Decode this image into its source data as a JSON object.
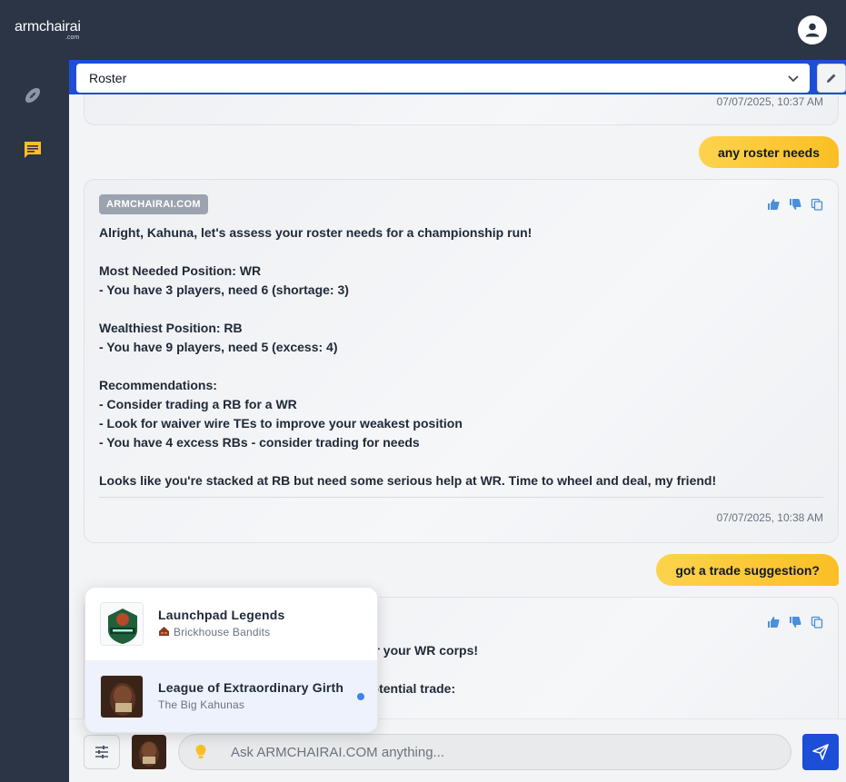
{
  "app": {
    "logo": "armchairai",
    "logo_sub": ".com"
  },
  "selector": {
    "value": "Roster"
  },
  "previous_message": {
    "timestamp": "07/07/2025, 10:37 AM"
  },
  "messages": [
    {
      "role": "user",
      "text": "any roster needs"
    },
    {
      "role": "assistant",
      "badge": "ARMCHAIRAI.COM",
      "lines": [
        "Alright, Kahuna, let's assess your roster needs for a championship run!",
        "",
        "Most Needed Position: WR",
        "- You have 3 players, need 6 (shortage: 3)",
        "",
        "Wealthiest Position: RB",
        "- You have 9 players, need 5 (excess: 4)",
        "",
        "Recommendations:",
        "- Consider trading a RB for a WR",
        "- Look for waiver wire TEs to improve your weakest position",
        "- You have 4 excess RBs - consider trading for needs",
        "",
        "Looks like you're stacked at RB but need some serious help at WR. Time to wheel and deal, my friend!"
      ],
      "timestamp": "07/07/2025, 10:38 AM"
    },
    {
      "role": "user",
      "text": "got a trade suggestion?"
    },
    {
      "role": "assistant",
      "partial_lines": [
        "ter your WR corps!",
        "potential trade:"
      ]
    }
  ],
  "league_dropdown": [
    {
      "league": "Launchpad Legends",
      "team": "Brickhouse Bandits",
      "selected": false
    },
    {
      "league": "League of Extraordinary Girth",
      "team": "The Big Kahunas",
      "selected": true
    }
  ],
  "input": {
    "placeholder": "Ask ARMCHAIRAI.COM anything..."
  },
  "colors": {
    "accent": "#1d4ed8",
    "user_bubble": "#fbbf24",
    "sidebar": "#2b3546",
    "chat_icon": "#fbbf24"
  }
}
